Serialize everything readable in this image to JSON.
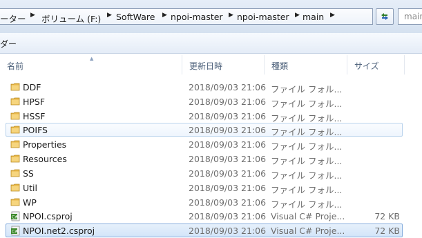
{
  "address_bar": {
    "crumbs": [
      "ーター",
      "ボリューム (F:)",
      "SoftWare",
      "npoi-master",
      "npoi-master",
      "main"
    ],
    "refresh_icon": "refresh-icon"
  },
  "search": {
    "placeholder": "main"
  },
  "toolbar": {
    "label": "ダー"
  },
  "columns": {
    "name": "名前",
    "date": "更新日時",
    "type": "種類",
    "size": "サイズ"
  },
  "files": [
    {
      "name": "DDF",
      "date": "2018/09/03 21:06",
      "type": "ファイル フォル...",
      "size": "",
      "icon": "folder-icon"
    },
    {
      "name": "HPSF",
      "date": "2018/09/03 21:06",
      "type": "ファイル フォル...",
      "size": "",
      "icon": "folder-icon"
    },
    {
      "name": "HSSF",
      "date": "2018/09/03 21:06",
      "type": "ファイル フォル...",
      "size": "",
      "icon": "folder-icon"
    },
    {
      "name": "POIFS",
      "date": "2018/09/03 21:06",
      "type": "ファイル フォル...",
      "size": "",
      "icon": "folder-icon"
    },
    {
      "name": "Properties",
      "date": "2018/09/03 21:06",
      "type": "ファイル フォル...",
      "size": "",
      "icon": "folder-icon"
    },
    {
      "name": "Resources",
      "date": "2018/09/03 21:06",
      "type": "ファイル フォル...",
      "size": "",
      "icon": "folder-icon"
    },
    {
      "name": "SS",
      "date": "2018/09/03 21:06",
      "type": "ファイル フォル...",
      "size": "",
      "icon": "folder-icon"
    },
    {
      "name": "Util",
      "date": "2018/09/03 21:06",
      "type": "ファイル フォル...",
      "size": "",
      "icon": "folder-icon"
    },
    {
      "name": "WP",
      "date": "2018/09/03 21:06",
      "type": "ファイル フォル...",
      "size": "",
      "icon": "folder-icon"
    },
    {
      "name": "NPOI.csproj",
      "date": "2018/09/03 21:06",
      "type": "Visual C# Proje...",
      "size": "72 KB",
      "icon": "csproj-file-icon"
    },
    {
      "name": "NPOI.net2.csproj",
      "date": "2018/09/03 21:06",
      "type": "Visual C# Proje...",
      "size": "72 KB",
      "icon": "csproj-file-icon"
    }
  ],
  "colors": {
    "folder": "#e8b84a",
    "hover_border": "#b8d2ec",
    "selected_border": "#84acdd",
    "csproj_green": "#3f8a2e"
  }
}
